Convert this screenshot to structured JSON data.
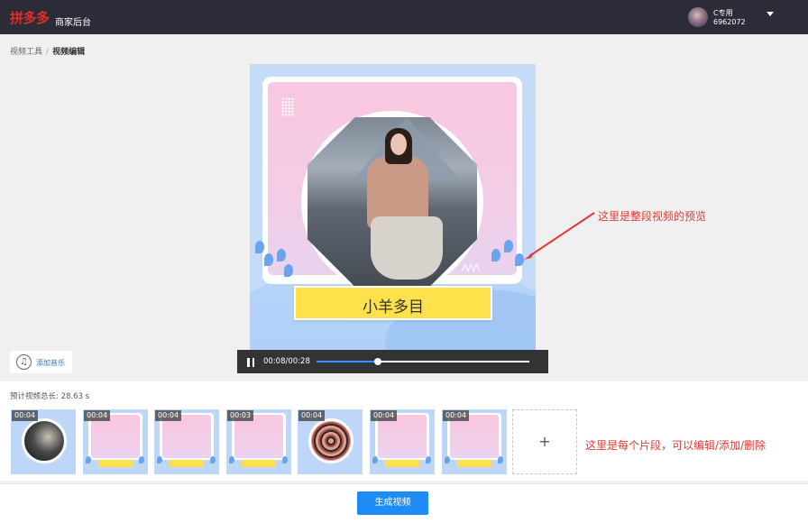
{
  "header": {
    "logo": "拼多多",
    "logo_sub": "商家后台",
    "user_name": "C专用",
    "user_id": "6962072"
  },
  "breadcrumb": {
    "parent": "视频工具",
    "separator": "/",
    "current": "视频编辑"
  },
  "preview": {
    "title": "小羊多目",
    "current_time": "00:08",
    "total_time": "00:28",
    "progress": 0.29
  },
  "add_music_label": "添加音乐",
  "annotations": {
    "preview_note": "这里是整段视频的预览",
    "clips_note": "这里是每个片段，可以编辑/添加/删除"
  },
  "timeline": {
    "total_label": "预计视频总长: 28.63 s",
    "clips": [
      {
        "duration": "00:04",
        "kind": "photo-dark"
      },
      {
        "duration": "00:04",
        "kind": "template"
      },
      {
        "duration": "00:04",
        "kind": "template"
      },
      {
        "duration": "00:03",
        "kind": "template"
      },
      {
        "duration": "00:04",
        "kind": "photo-group"
      },
      {
        "duration": "00:04",
        "kind": "template"
      },
      {
        "duration": "00:04",
        "kind": "template"
      }
    ],
    "add_symbol": "+"
  },
  "footer": {
    "generate_label": "生成视频"
  },
  "colors": {
    "accent": "#1d8cf7",
    "brand": "#e02e24",
    "annotation": "#e53935"
  }
}
